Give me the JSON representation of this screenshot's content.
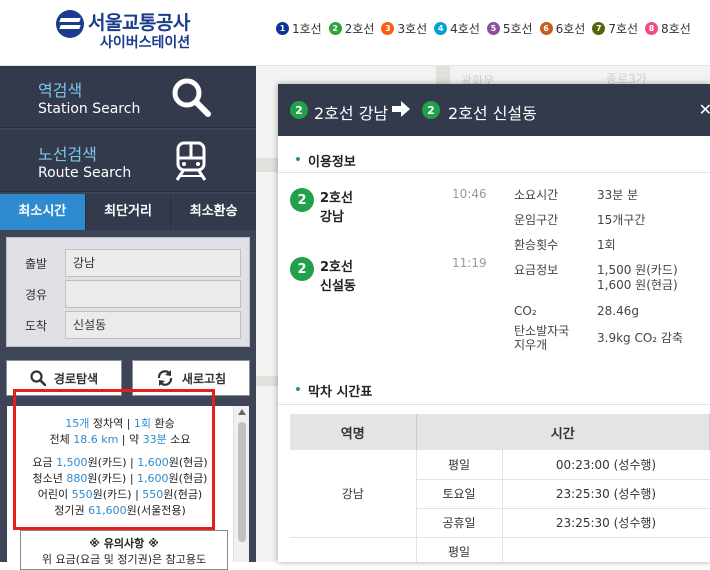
{
  "header": {
    "logo_title": "서울교통공사",
    "logo_subtitle": "사이버스테이션",
    "lines": [
      {
        "num": "1",
        "label": "1호선",
        "color": "#0d3692"
      },
      {
        "num": "2",
        "label": "2호선",
        "color": "#33a23d"
      },
      {
        "num": "3",
        "label": "3호선",
        "color": "#fe5d10"
      },
      {
        "num": "4",
        "label": "4호선",
        "color": "#00a2d1"
      },
      {
        "num": "5",
        "label": "5호선",
        "color": "#8b50a4"
      },
      {
        "num": "6",
        "label": "6호선",
        "color": "#c55c1d"
      },
      {
        "num": "7",
        "label": "7호선",
        "color": "#54640d"
      },
      {
        "num": "8",
        "label": "8호선",
        "color": "#f14c82"
      }
    ]
  },
  "map": {
    "labels": [
      "광화문",
      "종로3가"
    ]
  },
  "sidebar": {
    "station_search": {
      "ko": "역검색",
      "en": "Station Search",
      "icon": "search-icon"
    },
    "route_search": {
      "ko": "노선검색",
      "en": "Route Search",
      "icon": "train-icon"
    },
    "tabs": [
      "최소시간",
      "최단거리",
      "최소환승"
    ],
    "form": {
      "departure_label": "출발",
      "departure_value": "강남",
      "via_label": "경유",
      "via_value": "",
      "arrival_label": "도착",
      "arrival_value": "신설동"
    },
    "search_button": "경로탐색",
    "refresh_button": "새로고침",
    "result": {
      "stations": "15개",
      "stations_suffix": " 정차역 | ",
      "transfers": "1회",
      "transfers_suffix": " 환승",
      "total_prefix": "전체 ",
      "distance": "18.6 km",
      "mid": " | 약 ",
      "time": "33분",
      "time_suffix": " 소요",
      "fare_adult_label": "요금 ",
      "fare_adult_card": "1,500",
      "fare_adult_card_suffix": "원(카드) | ",
      "fare_adult_cash": "1,600",
      "fare_adult_cash_suffix": "원(현금)",
      "fare_youth_label": "청소년 ",
      "fare_youth_card": "880",
      "fare_youth_card_suffix": "원(카드) | ",
      "fare_youth_cash": "1,600",
      "fare_youth_cash_suffix": "원(현금)",
      "fare_child_label": "어린이 ",
      "fare_child_card": "550",
      "fare_child_card_suffix": "원(카드) | ",
      "fare_child_cash": "550",
      "fare_child_cash_suffix": "원(현금)",
      "pass_label": "정기권 ",
      "pass_value": "61,600",
      "pass_suffix": "원(서울전용)"
    },
    "notice_title": "※ 유의사항 ※",
    "notice_text": "위 요금(요금 및 정기권)은 참고용도"
  },
  "popup": {
    "from_line": "2",
    "from_text": "2호선 강남",
    "to_line": "2",
    "to_text": "2호선 신설동",
    "section_info": "이용정보",
    "stops": [
      {
        "line_num": "2",
        "line": "2호선",
        "name": "강남",
        "time": "10:46"
      },
      {
        "line_num": "2",
        "line": "2호선",
        "name": "신설동",
        "time": "11:19"
      }
    ],
    "info": {
      "time_label": "소요시간",
      "time_value": "33분 분",
      "section_label": "운임구간",
      "section_value": "15개구간",
      "transfer_label": "환승횟수",
      "transfer_value": "1회",
      "fare_label": "요금정보",
      "fare_card": "1,500 원(카드)",
      "fare_cash": "1,600 원(현금)",
      "co2_label": "CO₂",
      "co2_value": "28.46g",
      "carbon_label_1": "탄소발자국",
      "carbon_label_2": "지우개",
      "carbon_value": "3.9kg CO₂ 감축"
    },
    "section_last": "막차 시간표",
    "table": {
      "headers": [
        "역명",
        "시간"
      ],
      "station": "강남",
      "rows": [
        {
          "type": "평일",
          "time": "00:23:00 (성수행)"
        },
        {
          "type": "토요일",
          "time": "23:25:30 (성수행)"
        },
        {
          "type": "공휴일",
          "time": "23:25:30 (성수행)"
        },
        {
          "type": "평일",
          "time": ""
        }
      ]
    }
  }
}
